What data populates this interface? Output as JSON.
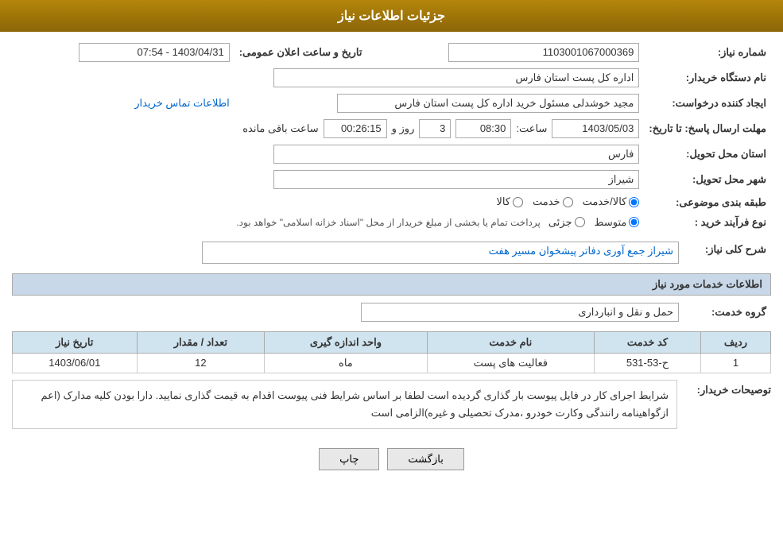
{
  "header": {
    "title": "جزئیات اطلاعات نیاز"
  },
  "form": {
    "need_number_label": "شماره نیاز:",
    "need_number_value": "1103001067000369",
    "buyer_org_label": "نام دستگاه خریدار:",
    "buyer_org_value": "اداره کل پست استان فارس",
    "announcement_label": "تاریخ و ساعت اعلان عمومی:",
    "announcement_value": "1403/04/31 - 07:54",
    "creator_label": "ایجاد کننده درخواست:",
    "creator_value": "مجید خوشدلی مسئول خرید اداره کل پست استان فارس",
    "contact_link": "اطلاعات تماس خریدار",
    "deadline_label": "مهلت ارسال پاسخ: تا تاریخ:",
    "deadline_date": "1403/05/03",
    "deadline_time_label": "ساعت:",
    "deadline_time": "08:30",
    "deadline_days_label": "روز و",
    "deadline_days": "3",
    "remaining_time_label": "ساعت باقی مانده",
    "remaining_time": "00:26:15",
    "province_label": "استان محل تحویل:",
    "province_value": "فارس",
    "city_label": "شهر محل تحویل:",
    "city_value": "شیراز",
    "category_label": "طبقه بندی موضوعی:",
    "category_options": [
      {
        "id": "kala",
        "label": "کالا"
      },
      {
        "id": "khadamat",
        "label": "خدمت"
      },
      {
        "id": "kala_khadamat",
        "label": "کالا/خدمت"
      }
    ],
    "category_selected": "kala_khadamat",
    "purchase_type_label": "نوع فرآیند خرید :",
    "purchase_type_options": [
      {
        "id": "jozei",
        "label": "جزئی"
      },
      {
        "id": "motavasset",
        "label": "متوسط"
      }
    ],
    "purchase_type_selected": "motavasset",
    "purchase_type_note": "پرداخت تمام یا بخشی از مبلغ خریدار از محل \"اسناد خزانه اسلامی\" خواهد بود.",
    "need_description_label": "شرح کلی نیاز:",
    "need_description_value": "شیراز جمع آوری دفاتر پیشخوان مسیر هفت"
  },
  "services_section": {
    "title": "اطلاعات خدمات مورد نیاز",
    "service_group_label": "گروه خدمت:",
    "service_group_value": "حمل و نقل و انبارداری",
    "table": {
      "headers": [
        "ردیف",
        "کد خدمت",
        "نام خدمت",
        "واحد اندازه گیری",
        "تعداد / مقدار",
        "تاریخ نیاز"
      ],
      "rows": [
        {
          "row_num": "1",
          "service_code": "ح-53-531",
          "service_name": "فعالیت های پست",
          "unit": "ماه",
          "quantity": "12",
          "need_date": "1403/06/01"
        }
      ]
    }
  },
  "buyer_notes": {
    "label": "توصیحات خریدار:",
    "text": "شرایط اجرای کار در فایل پیوست بار گذاری گردیده است لطفا بر اساس شرایط فنی پیوست اقدام به قیمت گذاری نمایید. دارا بودن کلیه مدارک (اعم ازگواهینامه رانندگی وکارت خودرو ،مدرک تحصیلی و غیره)الزامی است"
  },
  "buttons": {
    "print_label": "چاپ",
    "back_label": "بازگشت"
  }
}
